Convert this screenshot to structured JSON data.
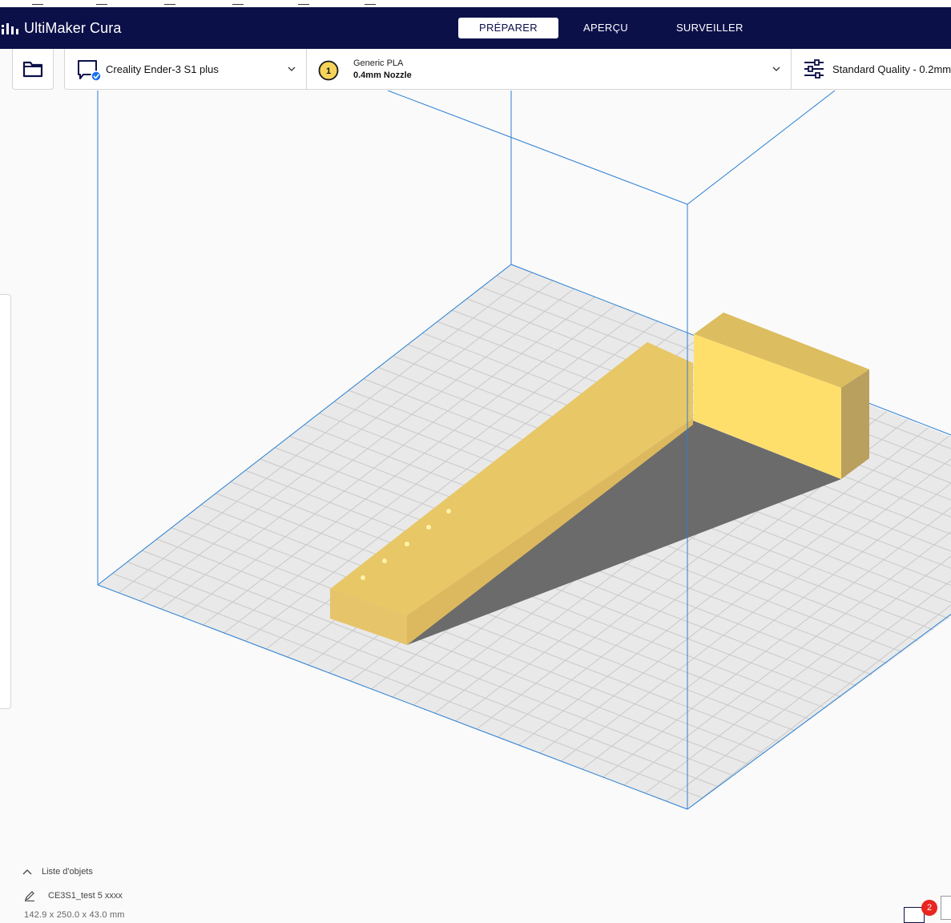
{
  "app": {
    "name": "UltiMaker Cura"
  },
  "stages": [
    {
      "label": "PRÉPARER",
      "active": true
    },
    {
      "label": "APERÇU",
      "active": false
    },
    {
      "label": "SURVEILLER",
      "active": false
    }
  ],
  "printer": {
    "name": "Creality Ender-3 S1 plus"
  },
  "extruder": {
    "index": "1",
    "material": "Generic PLA",
    "nozzle": "0.4mm Nozzle"
  },
  "quality": {
    "label": "Standard Quality - 0.2mm"
  },
  "object_list": {
    "toggle_label": "Liste d'objets",
    "job_name": "CE3S1_test 5 xxxx",
    "dimensions": "142.9 x 250.0 x 43.0 mm"
  },
  "notifications": {
    "count": "2"
  },
  "colors": {
    "header_bg": "#0c1049",
    "accent": "#196ef0",
    "model_top": "#f0d26e",
    "model_side": "#e2c063",
    "build_volume_line": "#2a7fd4",
    "badge": "#e8251f"
  }
}
